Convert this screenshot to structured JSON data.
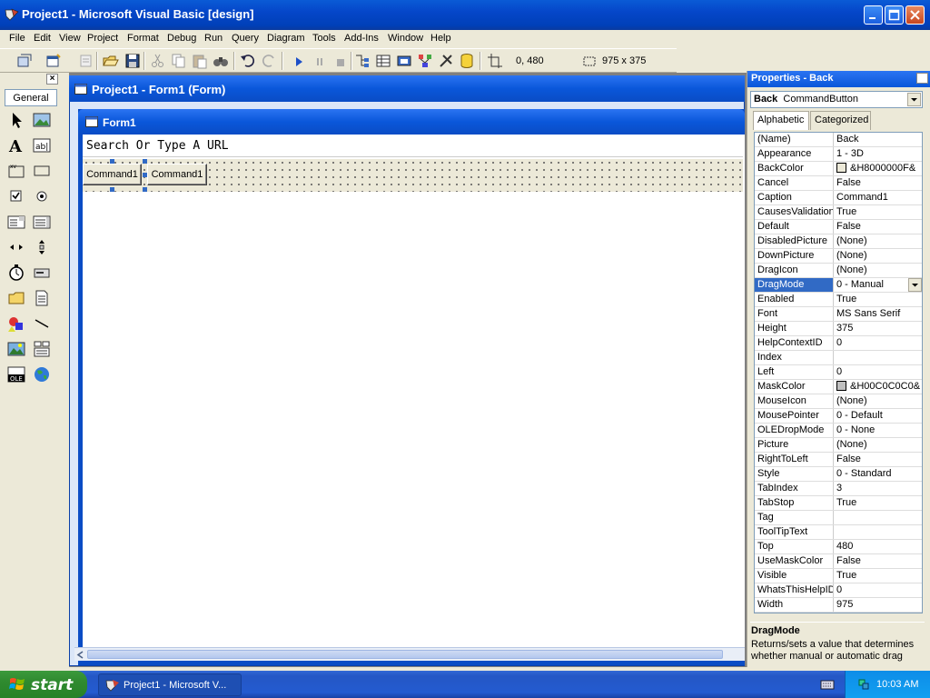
{
  "window": {
    "title": "Project1 - Microsoft Visual Basic [design]",
    "icon": "vb-app-icon",
    "controls": [
      "minimize-icon",
      "maximize-icon",
      "close-icon"
    ]
  },
  "menu": [
    "File",
    "Edit",
    "View",
    "Project",
    "Format",
    "Debug",
    "Run",
    "Query",
    "Diagram",
    "Tools",
    "Add-Ins",
    "Window",
    "Help"
  ],
  "toolbar": {
    "position": "0, 480",
    "size": "975 x 375"
  },
  "toolbox": {
    "tab": "General"
  },
  "project_window": {
    "title": "Project1 - Form1 (Form)"
  },
  "form": {
    "title": "Form1",
    "url_text": "Search Or Type A URL",
    "buttons": [
      "Command1",
      "Command1"
    ]
  },
  "properties": {
    "title": "Properties - Back",
    "object_name": "Back",
    "object_type": "CommandButton",
    "tabs": [
      "Alphabetic",
      "Categorized"
    ],
    "rows": [
      {
        "name": "(Name)",
        "value": "Back"
      },
      {
        "name": "Appearance",
        "value": "1 - 3D"
      },
      {
        "name": "BackColor",
        "value": "&H8000000F&",
        "swatch": "#ece9d8"
      },
      {
        "name": "Cancel",
        "value": "False"
      },
      {
        "name": "Caption",
        "value": "Command1"
      },
      {
        "name": "CausesValidation",
        "value": "True"
      },
      {
        "name": "Default",
        "value": "False"
      },
      {
        "name": "DisabledPicture",
        "value": "(None)"
      },
      {
        "name": "DownPicture",
        "value": "(None)"
      },
      {
        "name": "DragIcon",
        "value": "(None)"
      },
      {
        "name": "DragMode",
        "value": "0 - Manual",
        "selected": true
      },
      {
        "name": "Enabled",
        "value": "True"
      },
      {
        "name": "Font",
        "value": "MS Sans Serif"
      },
      {
        "name": "Height",
        "value": "375"
      },
      {
        "name": "HelpContextID",
        "value": "0"
      },
      {
        "name": "Index",
        "value": ""
      },
      {
        "name": "Left",
        "value": "0"
      },
      {
        "name": "MaskColor",
        "value": "&H00C0C0C0&",
        "swatch": "#c0c0c0"
      },
      {
        "name": "MouseIcon",
        "value": "(None)"
      },
      {
        "name": "MousePointer",
        "value": "0 - Default"
      },
      {
        "name": "OLEDropMode",
        "value": "0 - None"
      },
      {
        "name": "Picture",
        "value": "(None)"
      },
      {
        "name": "RightToLeft",
        "value": "False"
      },
      {
        "name": "Style",
        "value": "0 - Standard"
      },
      {
        "name": "TabIndex",
        "value": "3"
      },
      {
        "name": "TabStop",
        "value": "True"
      },
      {
        "name": "Tag",
        "value": ""
      },
      {
        "name": "ToolTipText",
        "value": ""
      },
      {
        "name": "Top",
        "value": "480"
      },
      {
        "name": "UseMaskColor",
        "value": "False"
      },
      {
        "name": "Visible",
        "value": "True"
      },
      {
        "name": "WhatsThisHelpID",
        "value": "0"
      },
      {
        "name": "Width",
        "value": "975"
      }
    ],
    "description_name": "DragMode",
    "description_text": "Returns/sets a value that determines whether manual or automatic drag"
  },
  "taskbar": {
    "start": "start",
    "task": "Project1 - Microsoft V...",
    "clock": "10:03 AM"
  },
  "colors": {
    "title_blue": "#0a57da",
    "selection": "#316ac5",
    "start_green": "#2f8a2f"
  }
}
